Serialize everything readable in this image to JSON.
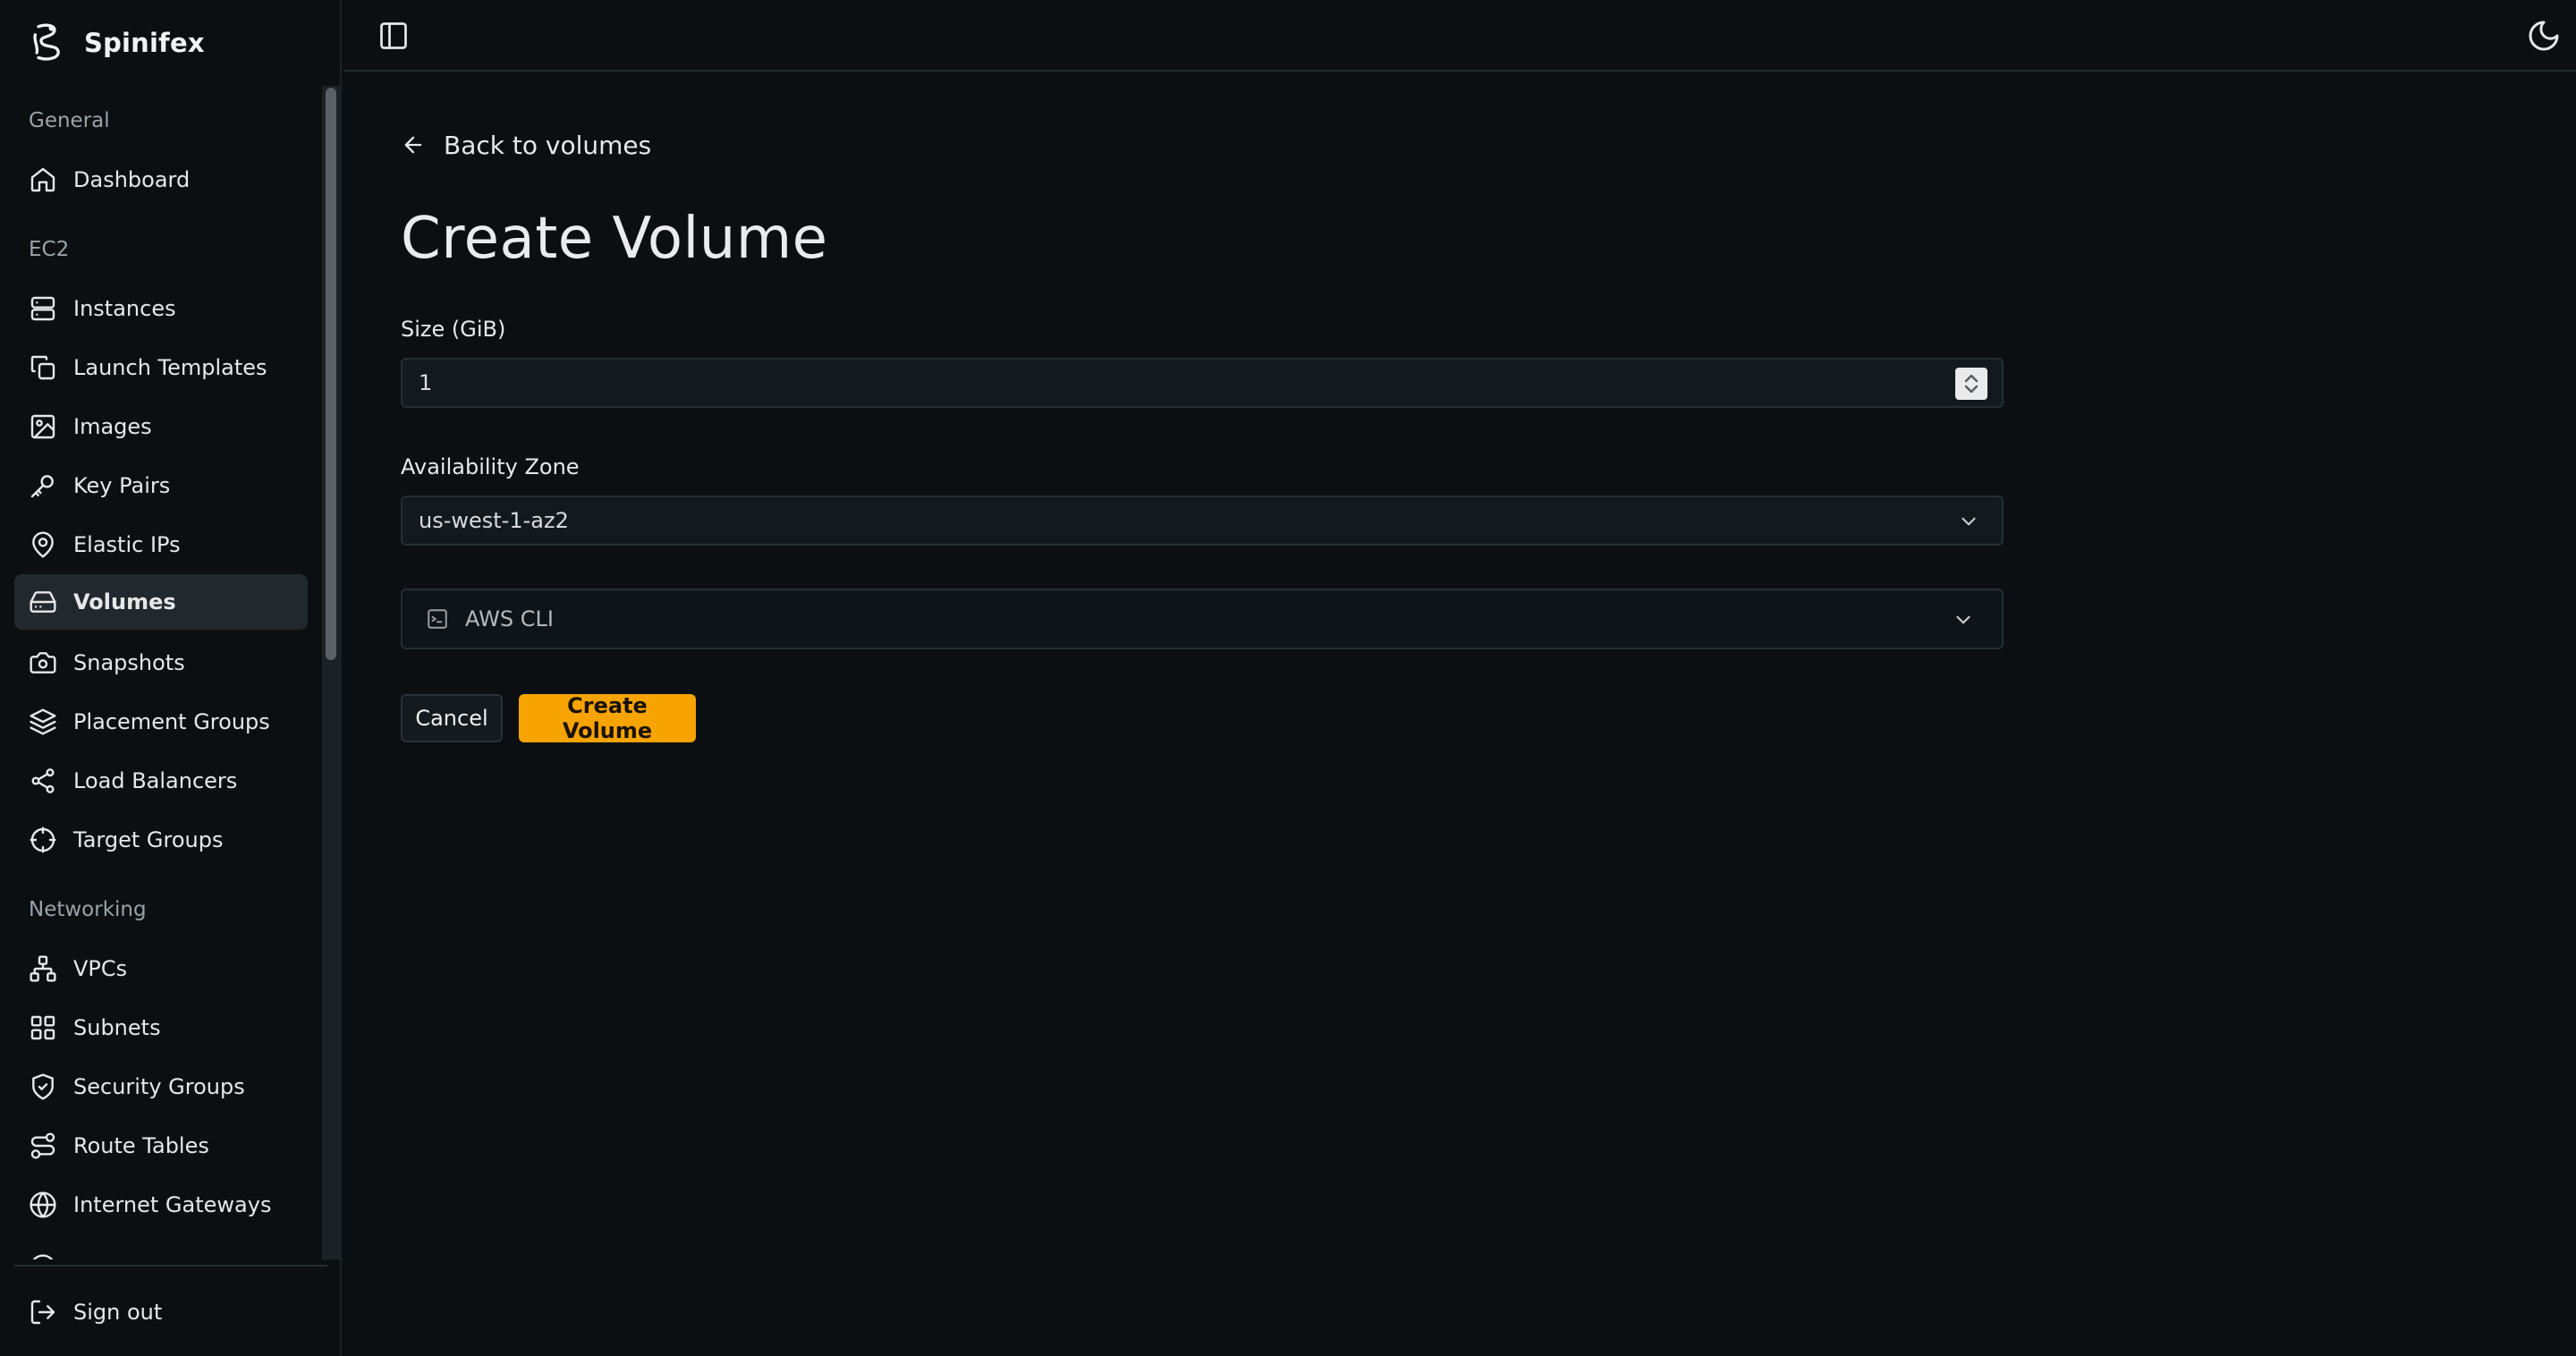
{
  "brand": {
    "name": "Spinifex"
  },
  "sidebar": {
    "sections": [
      {
        "label": "General",
        "items": [
          {
            "label": "Dashboard",
            "icon": "home-icon"
          }
        ]
      },
      {
        "label": "EC2",
        "items": [
          {
            "label": "Instances",
            "icon": "server-icon"
          },
          {
            "label": "Launch Templates",
            "icon": "copy-icon"
          },
          {
            "label": "Images",
            "icon": "image-icon"
          },
          {
            "label": "Key Pairs",
            "icon": "key-icon"
          },
          {
            "label": "Elastic IPs",
            "icon": "map-pin-icon"
          },
          {
            "label": "Volumes",
            "icon": "hard-drive-icon",
            "active": true
          },
          {
            "label": "Snapshots",
            "icon": "camera-icon"
          },
          {
            "label": "Placement Groups",
            "icon": "layers-icon"
          },
          {
            "label": "Load Balancers",
            "icon": "workflow-icon"
          },
          {
            "label": "Target Groups",
            "icon": "crosshair-icon"
          }
        ]
      },
      {
        "label": "Networking",
        "items": [
          {
            "label": "VPCs",
            "icon": "network-icon"
          },
          {
            "label": "Subnets",
            "icon": "grid-icon"
          },
          {
            "label": "Security Groups",
            "icon": "shield-icon"
          },
          {
            "label": "Route Tables",
            "icon": "route-icon"
          },
          {
            "label": "Internet Gateways",
            "icon": "globe-icon"
          }
        ]
      }
    ],
    "signout": {
      "label": "Sign out",
      "icon": "log-out-icon"
    }
  },
  "topbar": {
    "toggle_icon": "panel-left-icon",
    "theme_icon": "moon-icon"
  },
  "main": {
    "back_label": "Back to volumes",
    "title": "Create Volume",
    "size": {
      "label": "Size (GiB)",
      "value": "1"
    },
    "zone": {
      "label": "Availability Zone",
      "value": "us-west-1-az2"
    },
    "cli": {
      "label": "AWS CLI"
    },
    "cancel_label": "Cancel",
    "create_label": "Create Volume"
  },
  "colors": {
    "accent": "#f7a400",
    "background": "#0b0f12",
    "active_item": "#22292e"
  }
}
